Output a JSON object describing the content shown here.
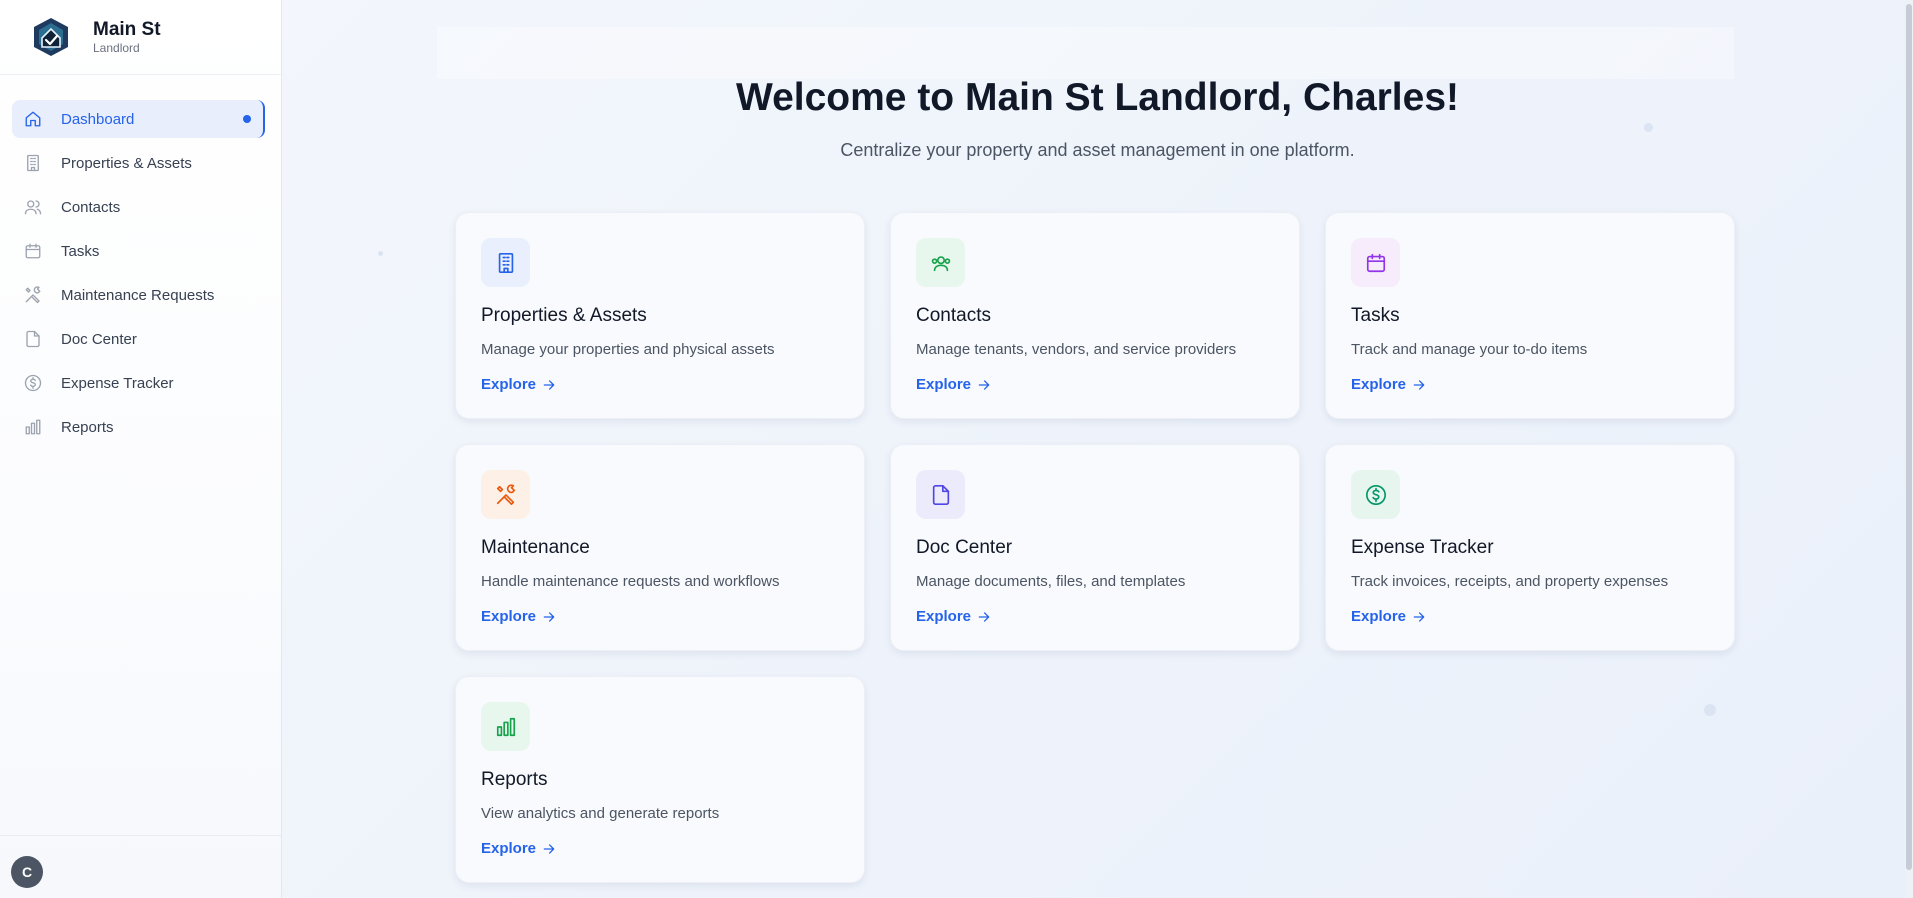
{
  "brand": {
    "name": "Main St",
    "subtitle": "Landlord"
  },
  "sidebar": {
    "items": [
      {
        "label": "Dashboard",
        "icon": "home-icon",
        "active": true
      },
      {
        "label": "Properties & Assets",
        "icon": "building-icon"
      },
      {
        "label": "Contacts",
        "icon": "users-icon"
      },
      {
        "label": "Tasks",
        "icon": "calendar-icon"
      },
      {
        "label": "Maintenance Requests",
        "icon": "tools-icon"
      },
      {
        "label": "Doc Center",
        "icon": "document-icon"
      },
      {
        "label": "Expense Tracker",
        "icon": "dollar-circle-icon"
      },
      {
        "label": "Reports",
        "icon": "bar-chart-icon"
      }
    ]
  },
  "user": {
    "initial": "C"
  },
  "main": {
    "title": "Welcome to Main St Landlord, Charles!",
    "subtitle": "Centralize your property and asset management in one platform.",
    "cards": [
      {
        "title": "Properties & Assets",
        "description": "Manage your properties and physical assets",
        "link": "Explore",
        "icon": "building-icon",
        "accent": "#2563eb",
        "bg": "#e9effc"
      },
      {
        "title": "Contacts",
        "description": "Manage tenants, vendors, and service providers",
        "link": "Explore",
        "icon": "users-icon",
        "accent": "#16a34a",
        "bg": "#e8f7ee"
      },
      {
        "title": "Tasks",
        "description": "Track and manage your to-do items",
        "link": "Explore",
        "icon": "calendar-icon",
        "accent": "#9333ea",
        "bg": "#f6ecfb"
      },
      {
        "title": "Maintenance",
        "description": "Handle maintenance requests and workflows",
        "link": "Explore",
        "icon": "tools-icon",
        "accent": "#ea580c",
        "bg": "#fdf0e6"
      },
      {
        "title": "Doc Center",
        "description": "Manage documents, files, and templates",
        "link": "Explore",
        "icon": "document-icon",
        "accent": "#4f46e5",
        "bg": "#ebebfb"
      },
      {
        "title": "Expense Tracker",
        "description": "Track invoices, receipts, and property expenses",
        "link": "Explore",
        "icon": "dollar-circle-icon",
        "accent": "#059669",
        "bg": "#e6f6ef"
      },
      {
        "title": "Reports",
        "description": "View analytics and generate reports",
        "link": "Explore",
        "icon": "bar-chart-icon",
        "accent": "#16a34a",
        "bg": "#e8f7ee"
      }
    ]
  }
}
